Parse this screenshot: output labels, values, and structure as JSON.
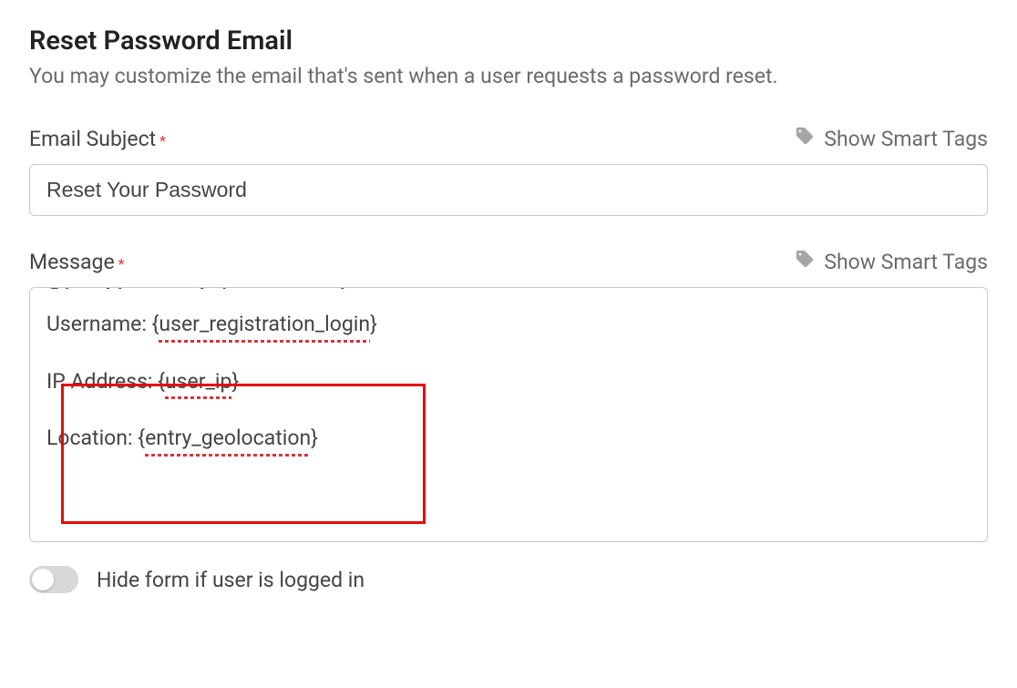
{
  "section": {
    "title": "Reset Password Email",
    "description": "You may customize the email that's sent when a user requests a password reset."
  },
  "emailSubject": {
    "label": "Email Subject",
    "value": "Reset Your Password",
    "smartTags": "Show Smart Tags"
  },
  "message": {
    "label": "Message",
    "smartTags": "Show Smart Tags",
    "partialTopLine": {
      "prefix": "Site Name: {",
      "tag": "site_name",
      "suffix": "}"
    },
    "lines": [
      {
        "prefix": "Username: {",
        "tag": "user_registration_login",
        "suffix": "}"
      },
      {
        "prefix": "IP Address: {",
        "tag": "user_ip",
        "suffix": "}"
      },
      {
        "prefix": "Location: {",
        "tag": "entry_geolocation",
        "suffix": "}"
      }
    ]
  },
  "hideFormToggle": {
    "label": "Hide form if user is logged in",
    "checked": false
  }
}
